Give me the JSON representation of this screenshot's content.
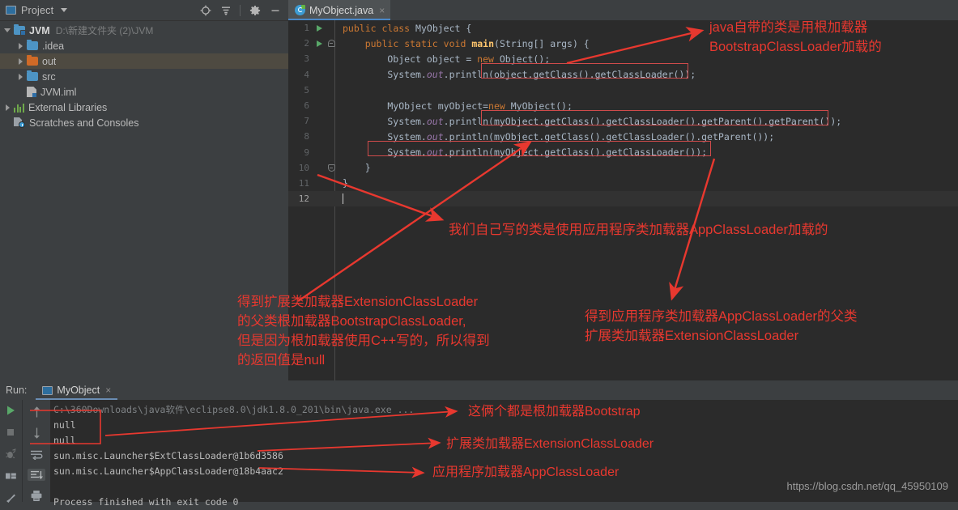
{
  "project_panel": {
    "title": "Project",
    "icons": [
      "project-icon",
      "chevron-down-icon",
      "locate-icon",
      "collapse-all-icon",
      "gear-icon",
      "minimize-icon"
    ],
    "tree": [
      {
        "label": "JVM",
        "path": "D:\\新建文件夹 (2)\\JVM",
        "icon": "folder-module",
        "expanded": true,
        "indent": 0,
        "selected": false
      },
      {
        "label": ".idea",
        "path": "",
        "icon": "folder-blue",
        "expanded": false,
        "indent": 1,
        "selected": false
      },
      {
        "label": "out",
        "path": "",
        "icon": "folder-orange",
        "expanded": false,
        "indent": 1,
        "selected": true
      },
      {
        "label": "src",
        "path": "",
        "icon": "folder-blue",
        "expanded": false,
        "indent": 1,
        "selected": false
      },
      {
        "label": "JVM.iml",
        "path": "",
        "icon": "iml-file",
        "expanded": null,
        "indent": 1,
        "selected": false
      },
      {
        "label": "External Libraries",
        "path": "",
        "icon": "libraries",
        "expanded": false,
        "indent": 0,
        "selected": false
      },
      {
        "label": "Scratches and Consoles",
        "path": "",
        "icon": "scratches",
        "expanded": null,
        "indent": 0,
        "selected": false
      }
    ]
  },
  "editor": {
    "tab": {
      "label": "MyObject.java",
      "icon": "java-class-icon",
      "close": "×"
    },
    "lines": [
      {
        "n": "1",
        "run": true,
        "fold": "",
        "code_html": "<span class='kw'>public</span> <span class='kw'>class</span> <span class='cls'>MyObject</span> {"
      },
      {
        "n": "2",
        "run": true,
        "fold": "top",
        "code_html": "    <span class='kw'>public</span> <span class='kw'>static</span> <span class='kw'>void</span> <span class='mname'>main</span>(<span class='cls'>String</span>[] args) {"
      },
      {
        "n": "3",
        "run": false,
        "fold": "",
        "code_html": "        Object object = <span class='kw'>new</span> Object();"
      },
      {
        "n": "4",
        "run": false,
        "fold": "",
        "code_html": "        System.<span class='fld'>out</span>.println(object.getClass().getClassLoader());"
      },
      {
        "n": "5",
        "run": false,
        "fold": "",
        "code_html": ""
      },
      {
        "n": "6",
        "run": false,
        "fold": "",
        "code_html": "        MyObject myObject=<span class='kw'>new</span> MyObject();"
      },
      {
        "n": "7",
        "run": false,
        "fold": "",
        "code_html": "        System.<span class='fld'>out</span>.println(myObject.getClass().getClassLoader().getParent().getParent());"
      },
      {
        "n": "8",
        "run": false,
        "fold": "",
        "code_html": "        System.<span class='fld'>out</span>.println(myObject.getClass().getClassLoader().getParent());"
      },
      {
        "n": "9",
        "run": false,
        "fold": "",
        "code_html": "        System.<span class='fld'>out</span>.println(myObject.getClass().getClassLoader());"
      },
      {
        "n": "10",
        "run": false,
        "fold": "bot",
        "code_html": "    }"
      },
      {
        "n": "11",
        "run": false,
        "fold": "",
        "code_html": "}"
      },
      {
        "n": "12",
        "run": false,
        "fold": "",
        "code_html": "<span class='caret'></span>",
        "current": true
      }
    ]
  },
  "run_panel": {
    "label": "Run:",
    "tab": {
      "label": "MyObject",
      "close": "×"
    },
    "left_tools": [
      "run-icon",
      "stop-icon",
      "debug-icon",
      "layout-icon",
      "pin-icon"
    ],
    "side_tools": [
      "scroll-up-icon",
      "scroll-down-icon",
      "soft-wrap-icon",
      "scroll-to-end-icon",
      "print-icon"
    ],
    "console": [
      {
        "text": "C:\\360Downloads\\java软件\\eclipse8.0\\jdk1.8.0_201\\bin\\java.exe ...",
        "dim": true
      },
      {
        "text": "null",
        "dim": false
      },
      {
        "text": "null",
        "dim": false
      },
      {
        "text": "sun.misc.Launcher$ExtClassLoader@1b6d3586",
        "dim": false
      },
      {
        "text": "sun.misc.Launcher$AppClassLoader@18b4aac2",
        "dim": false
      },
      {
        "text": "",
        "dim": false
      },
      {
        "text": "Process finished with exit code 0",
        "dim": false
      }
    ]
  },
  "annotations": {
    "color": "#e8382f",
    "top_right": "java自带的类是用根加载器\nBootstrapClassLoader加载的",
    "middle": "我们自己写的类是使用应用程序类加载器AppClassLoader加载的",
    "bottom_left": "得到扩展类加载器ExtensionClassLoader\n的父类根加载器BootstrapClassLoader,\n但是因为根加载器使用C++写的，所以得到\n的返回值是null",
    "bottom_right": "得到应用程序类加载器AppClassLoader的父类\n扩展类加载器ExtensionClassLoader",
    "console_1": "这俩个都是根加载器Bootstrap",
    "console_2": "扩展类加载器ExtensionClassLoader",
    "console_3": "应用程序加载器AppClassLoader"
  },
  "watermark": "https://blog.csdn.net/qq_45950109"
}
